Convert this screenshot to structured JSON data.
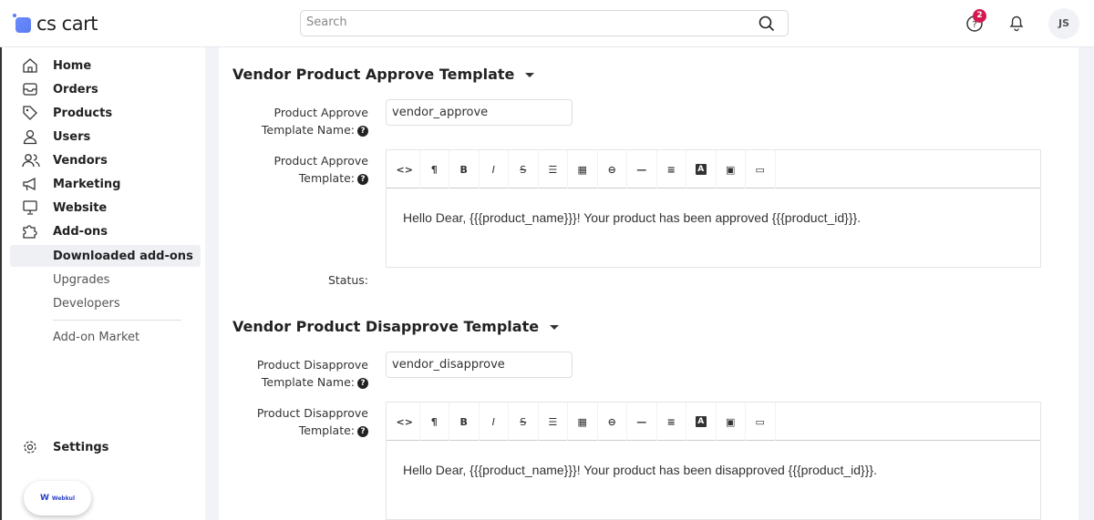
{
  "header": {
    "logo": "cs cart",
    "search_placeholder": "Search",
    "help_badge": "2",
    "avatar": "JS"
  },
  "sidebar": {
    "items": [
      {
        "label": "Home",
        "icon": "home-icon"
      },
      {
        "label": "Orders",
        "icon": "inbox-icon"
      },
      {
        "label": "Products",
        "icon": "tag-icon"
      },
      {
        "label": "Users",
        "icon": "user-icon"
      },
      {
        "label": "Vendors",
        "icon": "users-icon"
      },
      {
        "label": "Marketing",
        "icon": "megaphone-icon"
      },
      {
        "label": "Website",
        "icon": "monitor-icon"
      },
      {
        "label": "Add-ons",
        "icon": "puzzle-icon"
      }
    ],
    "subitems": [
      "Downloaded add-ons",
      "Upgrades",
      "Developers",
      "Add-on Market"
    ],
    "settings": "Settings",
    "webkul": "Webkul"
  },
  "toolbar": [
    "<>",
    "¶",
    "B",
    "I",
    "S",
    "list",
    "table",
    "link",
    "hr",
    "align",
    "A",
    "image",
    "video"
  ],
  "sections": [
    {
      "title": "Vendor Product Approve Template",
      "name_label1": "Product Approve",
      "name_label2": "Template Name:",
      "name_value": "vendor_approve",
      "tpl_label1": "Product Approve",
      "tpl_label2": "Template:",
      "content": "Hello Dear, {{{product_name}}}! Your product has been approved {{{product_id}}}.",
      "status_label": "Status:"
    },
    {
      "title": "Vendor Product Disapprove Template",
      "name_label1": "Product Disapprove",
      "name_label2": "Template Name:",
      "name_value": "vendor_disapprove",
      "tpl_label1": "Product Disapprove",
      "tpl_label2": "Template:",
      "content": "Hello Dear, {{{product_name}}}! Your product has been disapproved {{{product_id}}}."
    }
  ]
}
